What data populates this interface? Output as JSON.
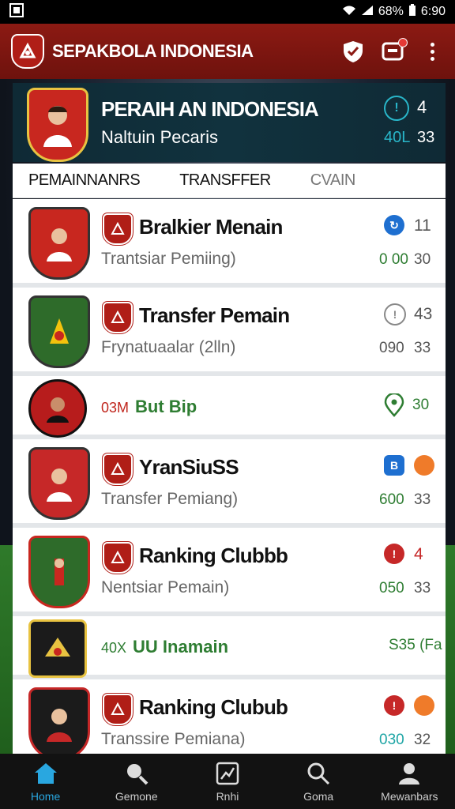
{
  "status": {
    "battery": "68%",
    "time": "6:90"
  },
  "app": {
    "title": "SEPAKBOLA INDONESIA",
    "logo_text": "S"
  },
  "hero": {
    "title": "PERAIH AN INDONESIA",
    "subtitle": "Naltuin Pecaris",
    "stat_icon": "!",
    "stat_num": "4",
    "stat_a": "40L",
    "stat_b": "33"
  },
  "tabs": [
    {
      "label": "PEMAINNANRS"
    },
    {
      "label": "TRANSFFER"
    },
    {
      "label": "CVAIN"
    }
  ],
  "rows": [
    {
      "type": "tall",
      "title": "Bralkier Menain",
      "subtitle": "Trantsiar Pemiing)",
      "ic1": "↻",
      "num1": "11",
      "a": "0 00",
      "b": "30",
      "crest": "#c8271f",
      "ic1_color": "#1e6fd0",
      "a_color": "#2e7d32"
    },
    {
      "type": "tall",
      "title": "Transfer Pemain",
      "subtitle": "Frynatuaalar (2lln)",
      "ic1": "!",
      "num1": "43",
      "a": "090",
      "b": "33",
      "crest": "#2e6b2a",
      "ic1_color": "outline",
      "a_color": "#555"
    },
    {
      "type": "short",
      "lead": "03M",
      "main": "But Bip",
      "num": "30",
      "crest": "#b71c1c"
    },
    {
      "type": "tall",
      "title": "YranSiuSS",
      "subtitle": "Transfer Pemiang)",
      "ic1": "B",
      "num1": "",
      "a": "600",
      "b": "33",
      "crest": "#c62828",
      "ic1_color": "#1e6fd0",
      "a_color": "#2e7d32",
      "ic2": "#ef7b2a"
    },
    {
      "type": "tall",
      "title": "Ranking Clubbb",
      "subtitle": "Nentsiar Pemain)",
      "ic1": "!",
      "num1": "4",
      "a": "050",
      "b": "33",
      "crest": "#2e6b2a",
      "ic1_color": "#c62828",
      "a_color": "#2e7d32"
    },
    {
      "type": "short",
      "lead": "40X",
      "main": "UU Inamain",
      "num": "S35 (Fa",
      "crest": "#1b1b1b"
    },
    {
      "type": "tall",
      "title": "Ranking Clubub",
      "subtitle": "Transsire Pemiana)",
      "ic1": "!",
      "num1": "",
      "a": "030",
      "b": "32",
      "crest": "#1b1b1b",
      "ic1_color": "#c62828",
      "a_color": "#1ea5a5",
      "ic2": "#ef7b2a"
    }
  ],
  "nav": [
    {
      "label": "Home",
      "icon": "home-icon"
    },
    {
      "label": "Gemone",
      "icon": "search-icon"
    },
    {
      "label": "Rnhi",
      "icon": "chart-icon"
    },
    {
      "label": "Goma",
      "icon": "search-icon"
    },
    {
      "label": "Mewanbars",
      "icon": "person-icon"
    }
  ]
}
